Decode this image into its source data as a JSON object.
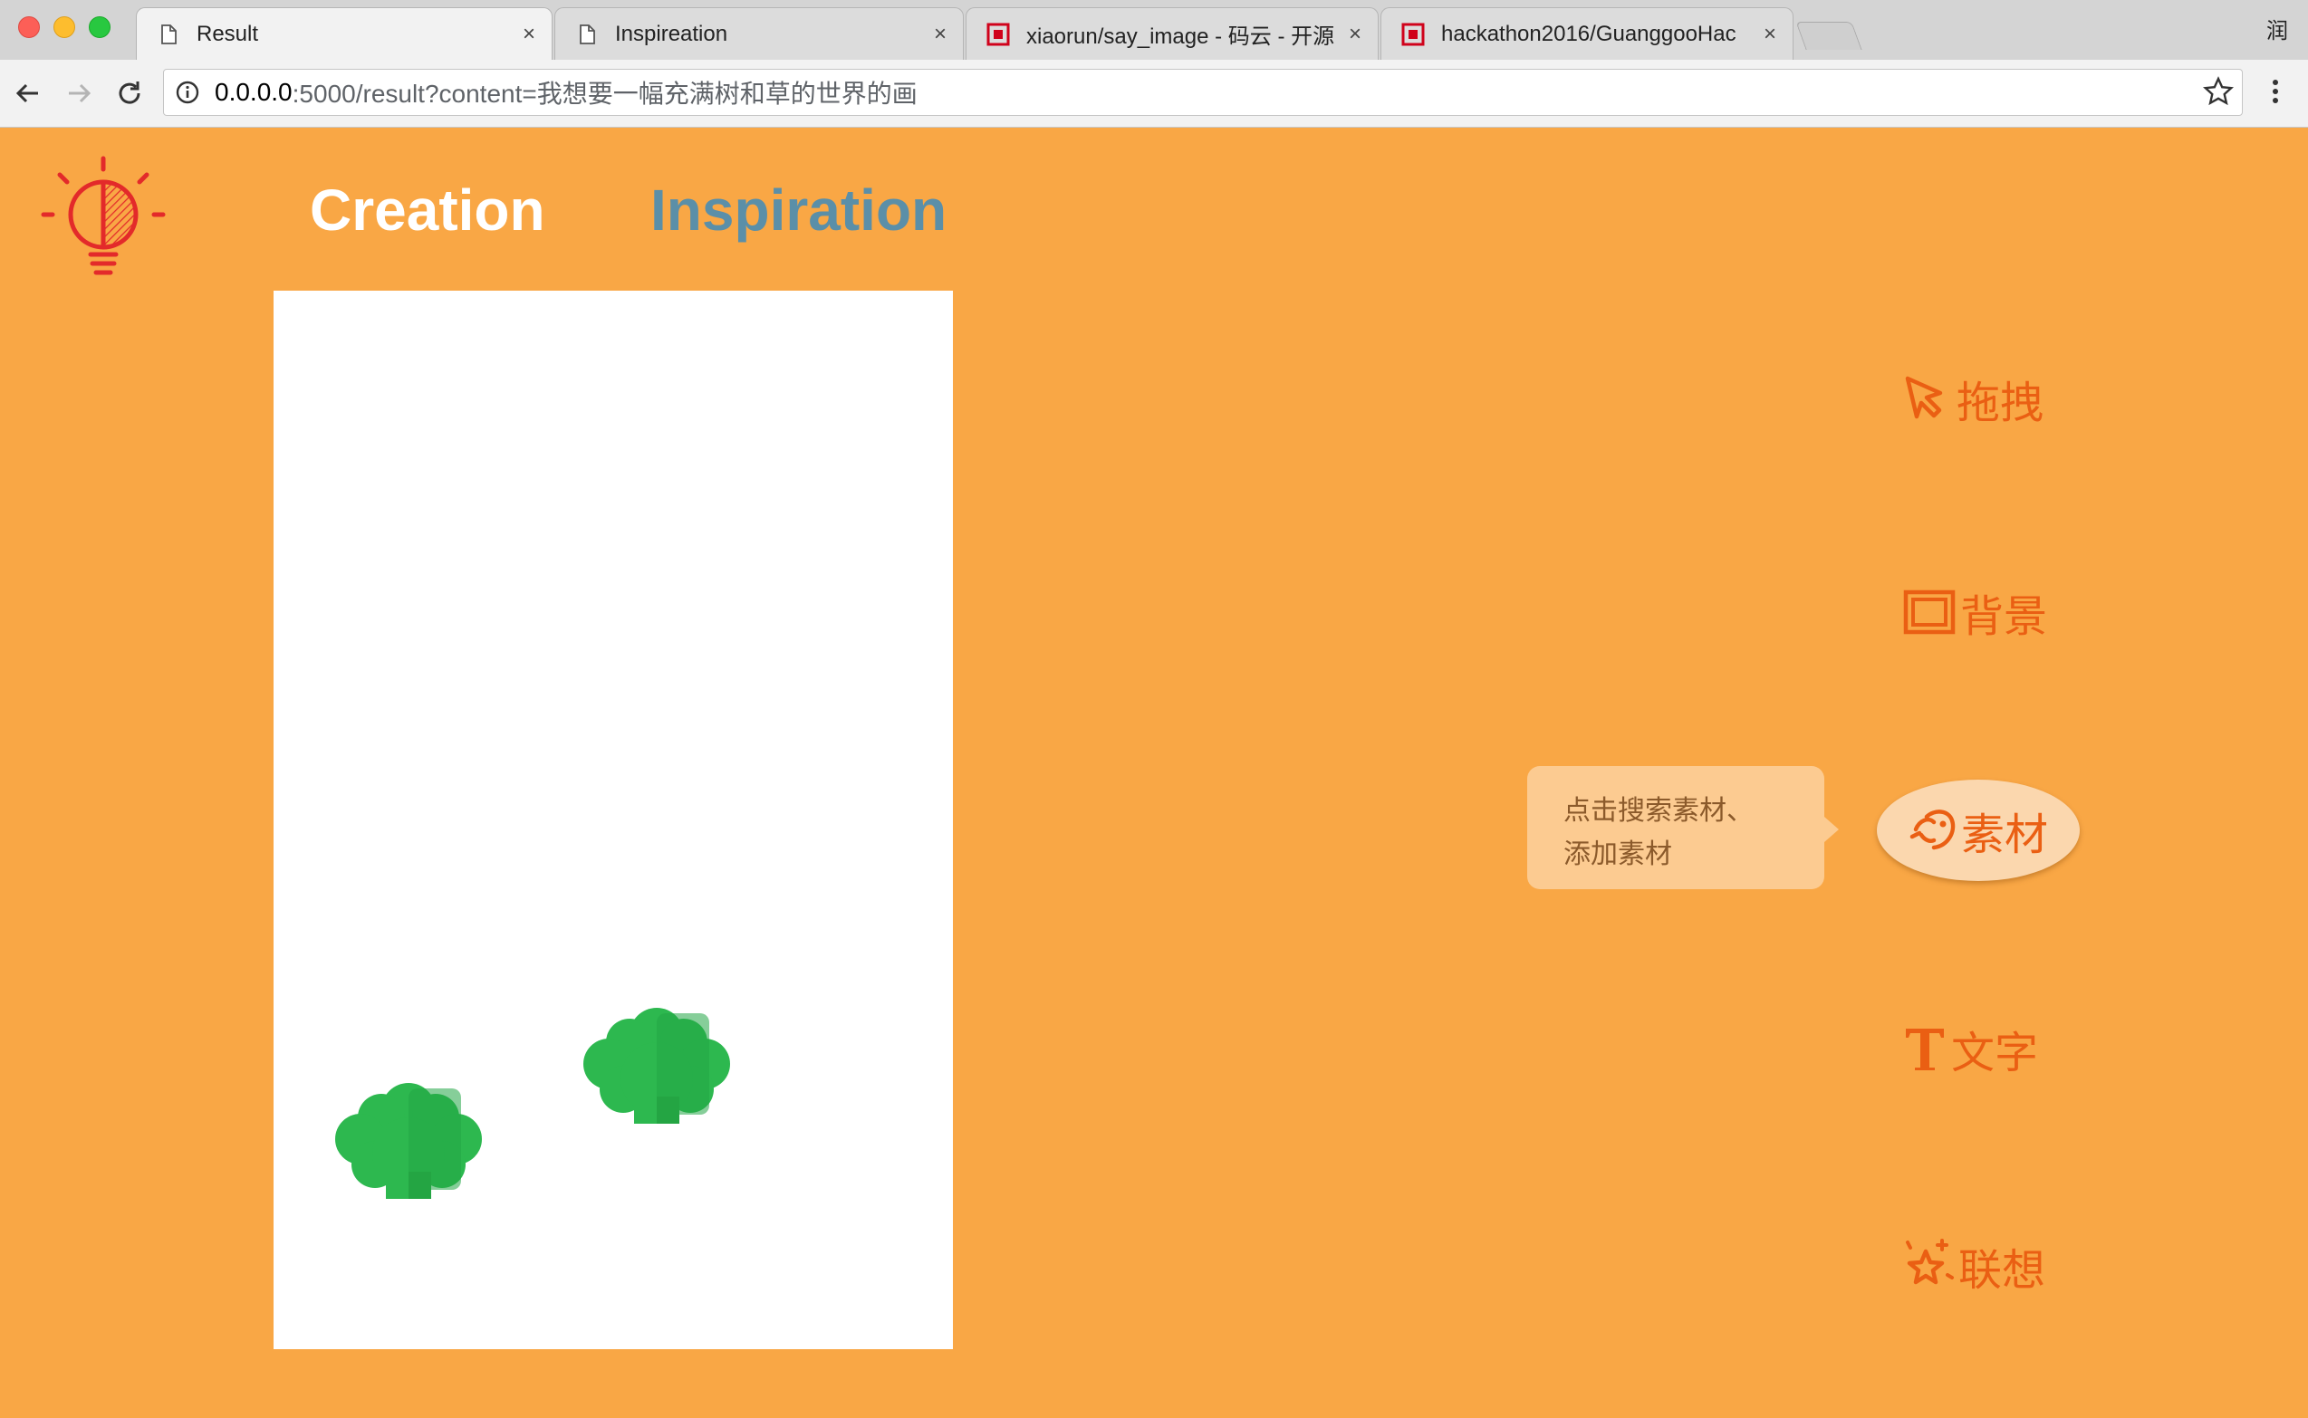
{
  "browser": {
    "tabs": [
      {
        "label": "Result",
        "icon": "page-icon",
        "active": true
      },
      {
        "label": "Inspireation",
        "icon": "page-icon",
        "active": false
      },
      {
        "label": "xiaorun/say_image - 码云 - 开源",
        "icon": "gitee-icon",
        "active": false
      },
      {
        "label": "hackathon2016/GuanggooHac",
        "icon": "gitee-icon",
        "active": false
      }
    ],
    "close_glyph": "×",
    "profile": "润",
    "url_host": "0.0.0.0",
    "url_path": ":5000/result?content=我想要一幅充满树和草的世界的画"
  },
  "nav": {
    "creation": "Creation",
    "inspiration": "Inspiration"
  },
  "tools": {
    "drag": "拖拽",
    "background": "背景",
    "material": "素材",
    "text": "文字",
    "associate": "联想"
  },
  "tooltip": {
    "line1": "点击搜索素材、",
    "line2": "添加素材"
  },
  "colors": {
    "page_bg": "#f9a745",
    "tool_color": "#ea5f13",
    "inspiration_link": "#5b8fa8",
    "tree_green": "#2db84f"
  }
}
